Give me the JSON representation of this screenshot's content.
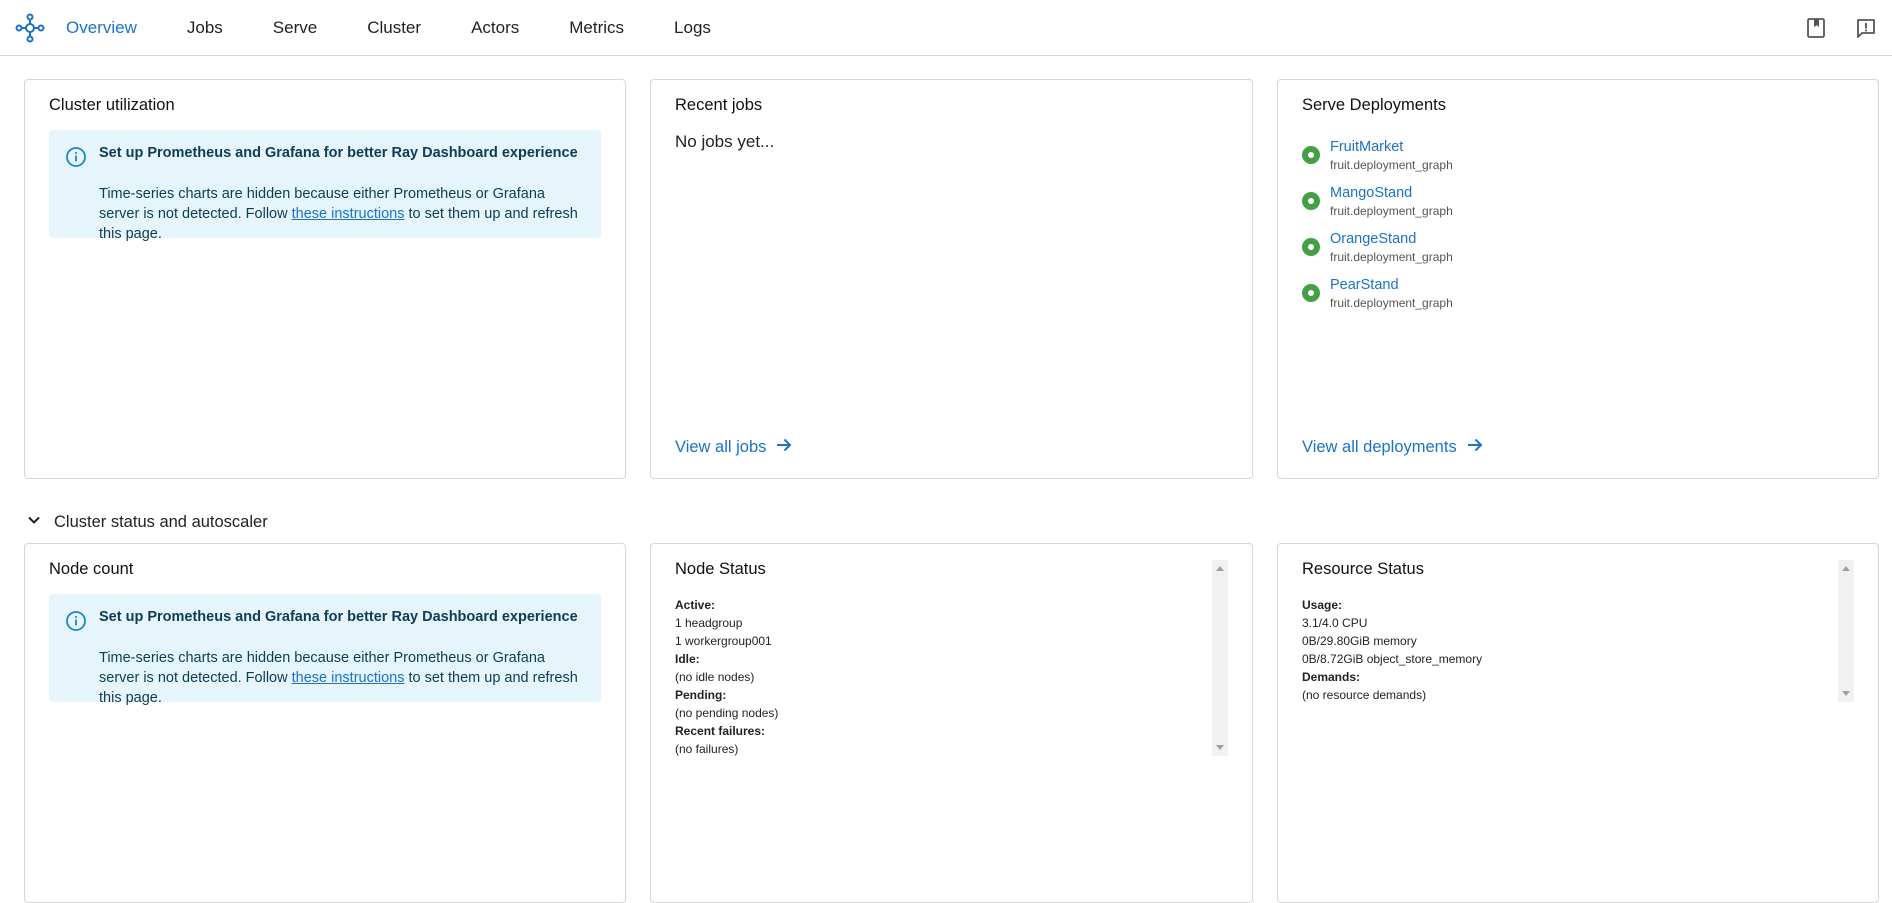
{
  "nav": {
    "tabs": [
      "Overview",
      "Jobs",
      "Serve",
      "Cluster",
      "Actors",
      "Metrics",
      "Logs"
    ],
    "active": "Overview",
    "accent_color": "#1a73c8"
  },
  "cluster_utilization": {
    "title": "Cluster utilization",
    "alert": {
      "title": "Set up Prometheus and Grafana for better Ray Dashboard experience",
      "body_pre": "Time-series charts are hidden because either Prometheus or Grafana server is not detected. Follow ",
      "link": "these instructions",
      "body_post": " to set them up and refresh this page."
    }
  },
  "recent_jobs": {
    "title": "Recent jobs",
    "empty": "No jobs yet...",
    "view_all": "View all jobs"
  },
  "serve_deployments": {
    "title": "Serve Deployments",
    "items": [
      {
        "name": "FruitMarket",
        "sub": "fruit.deployment_graph"
      },
      {
        "name": "MangoStand",
        "sub": "fruit.deployment_graph"
      },
      {
        "name": "OrangeStand",
        "sub": "fruit.deployment_graph"
      },
      {
        "name": "PearStand",
        "sub": "fruit.deployment_graph"
      }
    ],
    "view_all": "View all deployments",
    "status_color": "#43a047"
  },
  "section": {
    "label": "Cluster status and autoscaler"
  },
  "node_count": {
    "title": "Node count",
    "alert": {
      "title": "Set up Prometheus and Grafana for better Ray Dashboard experience",
      "body_pre": "Time-series charts are hidden because either Prometheus or Grafana server is not detected. Follow ",
      "link": "these instructions",
      "body_post": " to set them up and refresh this page."
    }
  },
  "node_status": {
    "title": "Node Status",
    "lines": [
      {
        "text": "Active:",
        "bold": true
      },
      {
        "text": "1 headgroup",
        "bold": false
      },
      {
        "text": "1 workergroup001",
        "bold": false
      },
      {
        "text": "Idle:",
        "bold": true
      },
      {
        "text": "(no idle nodes)",
        "bold": false
      },
      {
        "text": "Pending:",
        "bold": true
      },
      {
        "text": "(no pending nodes)",
        "bold": false
      },
      {
        "text": "Recent failures:",
        "bold": true
      },
      {
        "text": "(no failures)",
        "bold": false
      }
    ]
  },
  "resource_status": {
    "title": "Resource Status",
    "lines": [
      {
        "text": "Usage:",
        "bold": true
      },
      {
        "text": "3.1/4.0 CPU",
        "bold": false
      },
      {
        "text": "0B/29.80GiB memory",
        "bold": false
      },
      {
        "text": "0B/8.72GiB object_store_memory",
        "bold": false
      },
      {
        "text": "Demands:",
        "bold": true
      },
      {
        "text": "(no resource demands)",
        "bold": false
      }
    ]
  }
}
